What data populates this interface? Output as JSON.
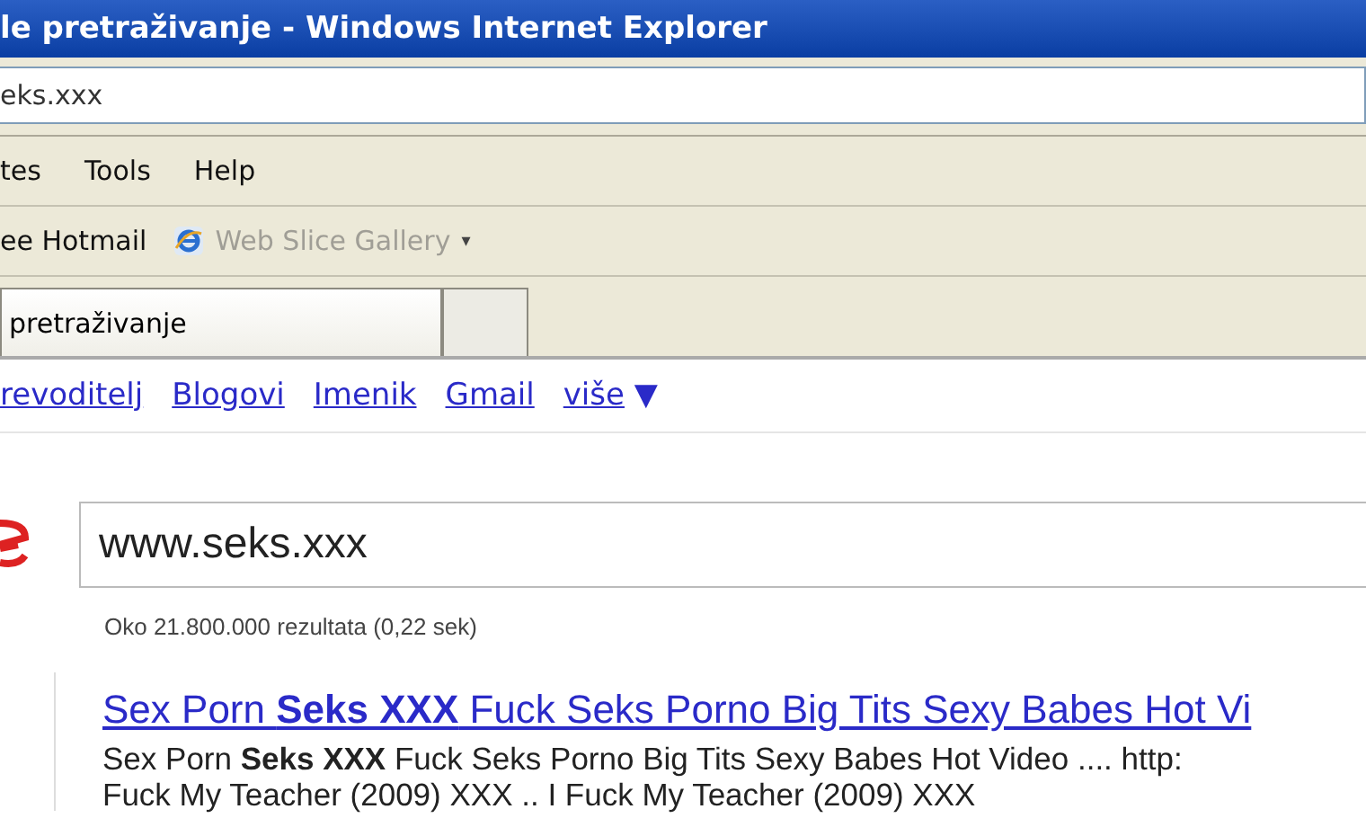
{
  "window": {
    "title": "le pretraživanje - Windows Internet Explorer"
  },
  "address_bar": {
    "value": "eks.xxx"
  },
  "menu": [
    "tes",
    "Tools",
    "Help"
  ],
  "favorites": [
    {
      "label": "ee Hotmail",
      "kind": "text",
      "disabled": false
    },
    {
      "label": "Web Slice Gallery",
      "kind": "ie",
      "disabled": true,
      "caret": "▾"
    }
  ],
  "tabs": [
    {
      "label": "pretraživanje",
      "selected": true
    },
    {
      "selected": false
    }
  ],
  "google_links": [
    "revoditelj",
    "Blogovi",
    "Imenik",
    "Gmail"
  ],
  "more_link": {
    "label": "više",
    "caret": "▼"
  },
  "search": {
    "value": "www.seks.xxx"
  },
  "result_stats": "Oko 21.800.000 rezultata (0,22 sek)",
  "results": [
    {
      "title": "Sex Porn **Seks XXX** Fuck Seks Porno Big Tits Sexy Babes Hot Vi",
      "snippet": "Sex Porn **Seks XXX** Fuck Seks Porno Big Tits Sexy Babes Hot Video .... http:",
      "snippet_line_2": "Fuck My Teacher (2009) XXX .. I Fuck My Teacher (2009) XXX"
    }
  ]
}
